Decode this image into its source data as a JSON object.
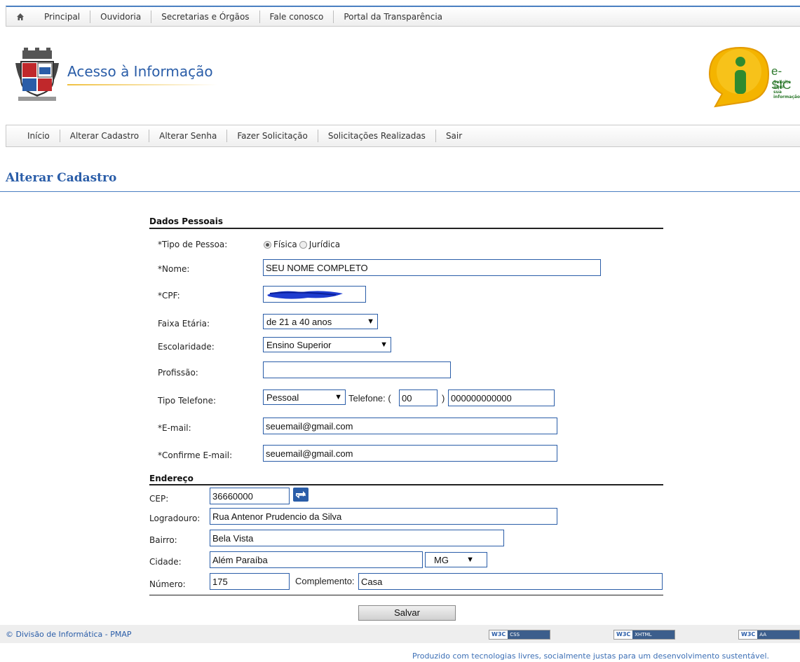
{
  "top_nav": {
    "items": [
      "Principal",
      "Ouvidoria",
      "Secretarias e Órgãos",
      "Fale conosco",
      "Portal da Transparência"
    ]
  },
  "header": {
    "site_title": "Acesso à Informação",
    "esic_title": "e-SIC",
    "esic_tagline_1": "Solicite aqui",
    "esic_tagline_2": "sua informação"
  },
  "main_nav": {
    "items": [
      "Início",
      "Alterar Cadastro",
      "Alterar Senha",
      "Fazer Solicitação",
      "Solicitações Realizadas",
      "Sair"
    ]
  },
  "page_title": "Alterar Cadastro",
  "dados_pessoais": {
    "section_title": "Dados Pessoais",
    "tipo_pessoa_label": "*Tipo de Pessoa:",
    "tipo_pessoa_options": [
      "Física",
      "Jurídica"
    ],
    "tipo_pessoa_selected": "Física",
    "nome_label": "*Nome:",
    "nome_value": "SEU NOME COMPLETO",
    "cpf_label": "*CPF:",
    "faixa_label": "Faixa Etária:",
    "faixa_value": "de 21 a 40 anos",
    "escolaridade_label": "Escolaridade:",
    "escolaridade_value": "Ensino Superior",
    "profissao_label": "Profissão:",
    "profissao_value": "",
    "tipo_telefone_label": "Tipo Telefone:",
    "tipo_telefone_value": "Pessoal",
    "telefone_label": "Telefone: (",
    "ddd_value": "00",
    "ddd_close": ")",
    "telefone_value": "000000000000",
    "email_label": "*E-mail:",
    "email_value": "seuemail@gmail.com",
    "confirm_email_label": "*Confirme E-mail:",
    "confirm_email_value": "seuemail@gmail.com"
  },
  "endereco": {
    "section_title": "Endereço",
    "cep_label": "CEP:",
    "cep_value": "36660000",
    "logradouro_label": "Logradouro:",
    "logradouro_value": "Rua Antenor Prudencio da Silva",
    "bairro_label": "Bairro:",
    "bairro_value": "Bela Vista",
    "cidade_label": "Cidade:",
    "cidade_value": "Além Paraíba",
    "uf_value": "MG",
    "numero_label": "Número:",
    "numero_value": "175",
    "complemento_label": "Complemento:",
    "complemento_value": "Casa"
  },
  "save_label": "Salvar",
  "footer": {
    "copyright": "© Divisão de Informática - PMAP",
    "badges": [
      {
        "w3": "W3C",
        "text": "CSS"
      },
      {
        "w3": "W3C",
        "text": "XHTML"
      },
      {
        "w3": "W3C",
        "text": "AA"
      }
    ],
    "produzido": "Produzido com tecnologias livres, socialmente justas para um desenvolvimento sustentável."
  },
  "colors": {
    "accent": "#2a5da8",
    "rule": "#4a7fc1"
  }
}
